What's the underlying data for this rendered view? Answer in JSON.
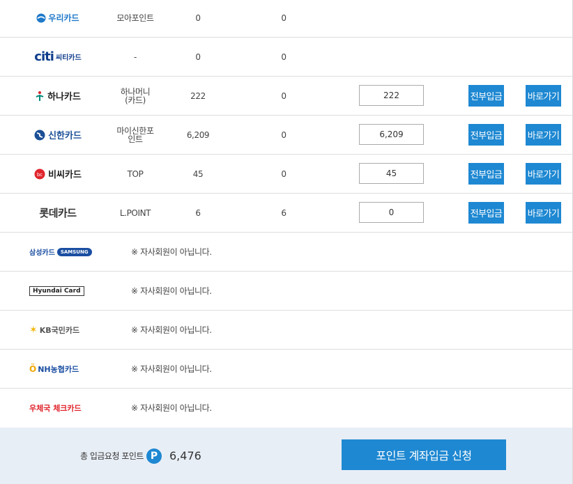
{
  "rows": [
    {
      "card": "우리카드",
      "point_name": "모아포인트",
      "held": "0",
      "min": "0"
    },
    {
      "card": "씨티카드",
      "point_name": "-",
      "held": "0",
      "min": "0"
    },
    {
      "card": "하나카드",
      "point_name_line1": "하나머니",
      "point_name_line2": "(카드)",
      "held": "222",
      "min": "0",
      "amount": "222",
      "all_label": "전부입금",
      "go_label": "바로가기"
    },
    {
      "card": "신한카드",
      "point_name_line1": "마이신한포",
      "point_name_line2": "인트",
      "held": "6,209",
      "min": "0",
      "amount": "6,209",
      "all_label": "전부입금",
      "go_label": "바로가기"
    },
    {
      "card": "비씨카드",
      "point_name": "TOP",
      "held": "45",
      "min": "0",
      "amount": "45",
      "all_label": "전부입금",
      "go_label": "바로가기"
    },
    {
      "card": "롯데카드",
      "point_name": "L.POINT",
      "held": "6",
      "min": "6",
      "amount": "0",
      "all_label": "전부입금",
      "go_label": "바로가기"
    }
  ],
  "non_members": [
    {
      "card": "삼성카드",
      "card_sub": "SAMSUNG",
      "note": "※ 자사회원이 아닙니다."
    },
    {
      "card": "Hyundai Card",
      "note": "※ 자사회원이 아닙니다."
    },
    {
      "card": "KB국민카드",
      "note": "※ 자사회원이 아닙니다."
    },
    {
      "card": "NH농협카드",
      "note": "※ 자사회원이 아닙니다."
    },
    {
      "card": "우체국 체크카드",
      "note": "※ 자사회원이 아닙니다."
    }
  ],
  "footer": {
    "total_label": "총 입금요청 포인트",
    "badge": "P",
    "total_value": "6,476",
    "submit_label": "포인트 계좌입금 신청"
  },
  "colors": {
    "accent": "#1e88d2",
    "footer_bg": "#e8eef6"
  }
}
